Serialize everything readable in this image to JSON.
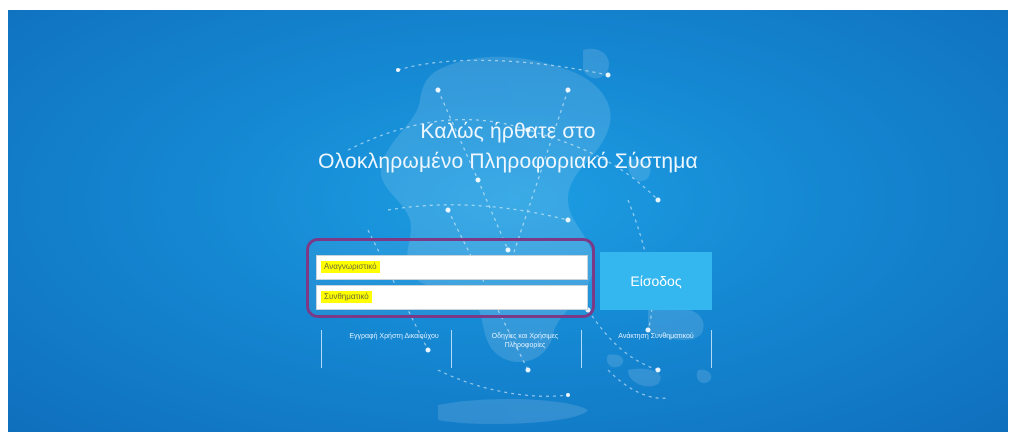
{
  "welcome": {
    "line1": "Καλώς ήρθατε στο",
    "line2": "Ολοκληρωμένο Πληροφοριακό Σύστημα"
  },
  "login": {
    "username_placeholder": "Αναγνωριστικό",
    "password_placeholder": "Συνθηματικό",
    "submit_label": "Είσοδος"
  },
  "links": [
    {
      "label": "Εγγραφή Χρήστη Δικαιούχου"
    },
    {
      "label": "Οδηγίες και Χρήσιμες Πληροφορίες"
    },
    {
      "label": "Ανάκτηση Συνθηματικού"
    }
  ],
  "colors": {
    "background": "#1587d2",
    "button": "#34b6ef",
    "highlight_border": "#7c3a86",
    "placeholder_highlight": "#ffff00"
  }
}
